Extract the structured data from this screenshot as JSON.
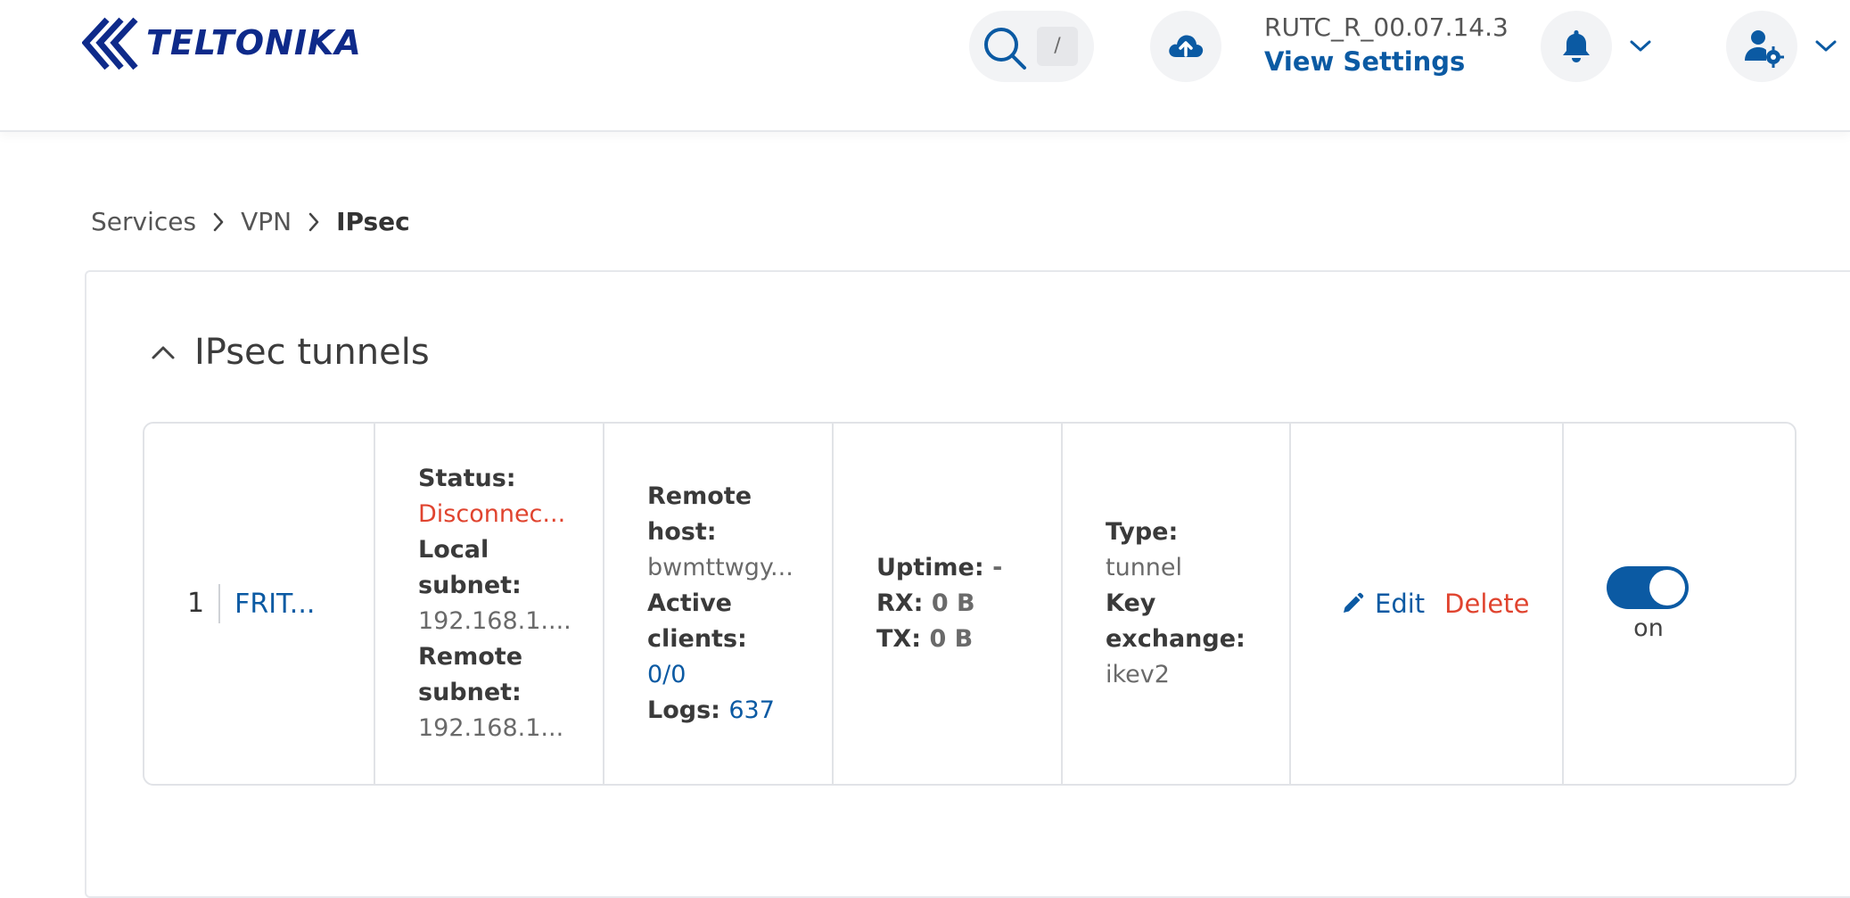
{
  "header": {
    "brand": "TELTONIKA",
    "search_shortcut": "/",
    "firmware_version": "RUTC_R_00.07.14.3",
    "view_settings_label": "View Settings",
    "icons": [
      "search-icon",
      "cloud-upload-icon",
      "bell-icon",
      "chevron-down-icon",
      "user-settings-icon"
    ]
  },
  "breadcrumb": {
    "items": [
      "Services",
      "VPN"
    ],
    "current": "IPsec"
  },
  "section": {
    "title": "IPsec tunnels"
  },
  "tunnel": {
    "index": "1",
    "name": "FRIT...",
    "status_label": "Status:",
    "status_value": "Disconnec...",
    "local_subnet_label": "Local subnet:",
    "local_subnet_value": "192.168.1....",
    "remote_subnet_label": "Remote subnet:",
    "remote_subnet_value": "192.168.1...",
    "remote_host_label": "Remote host:",
    "remote_host_value": "bwmttwgy...",
    "active_clients_label": "Active clients:",
    "active_clients_value": "0/0",
    "logs_label": "Logs:",
    "logs_value": "637",
    "uptime_label": "Uptime:",
    "uptime_value": "-",
    "rx_label": "RX:",
    "rx_value": "0 B",
    "tx_label": "TX:",
    "tx_value": "0 B",
    "type_label": "Type:",
    "type_value": "tunnel",
    "key_exchange_label": "Key exchange:",
    "key_exchange_value": "ikev2",
    "edit_label": "Edit",
    "delete_label": "Delete",
    "toggle_label": "on",
    "enabled": true
  },
  "colors": {
    "accent": "#0b5aa3",
    "danger": "#e0442f",
    "brand": "#0e2a8a"
  }
}
